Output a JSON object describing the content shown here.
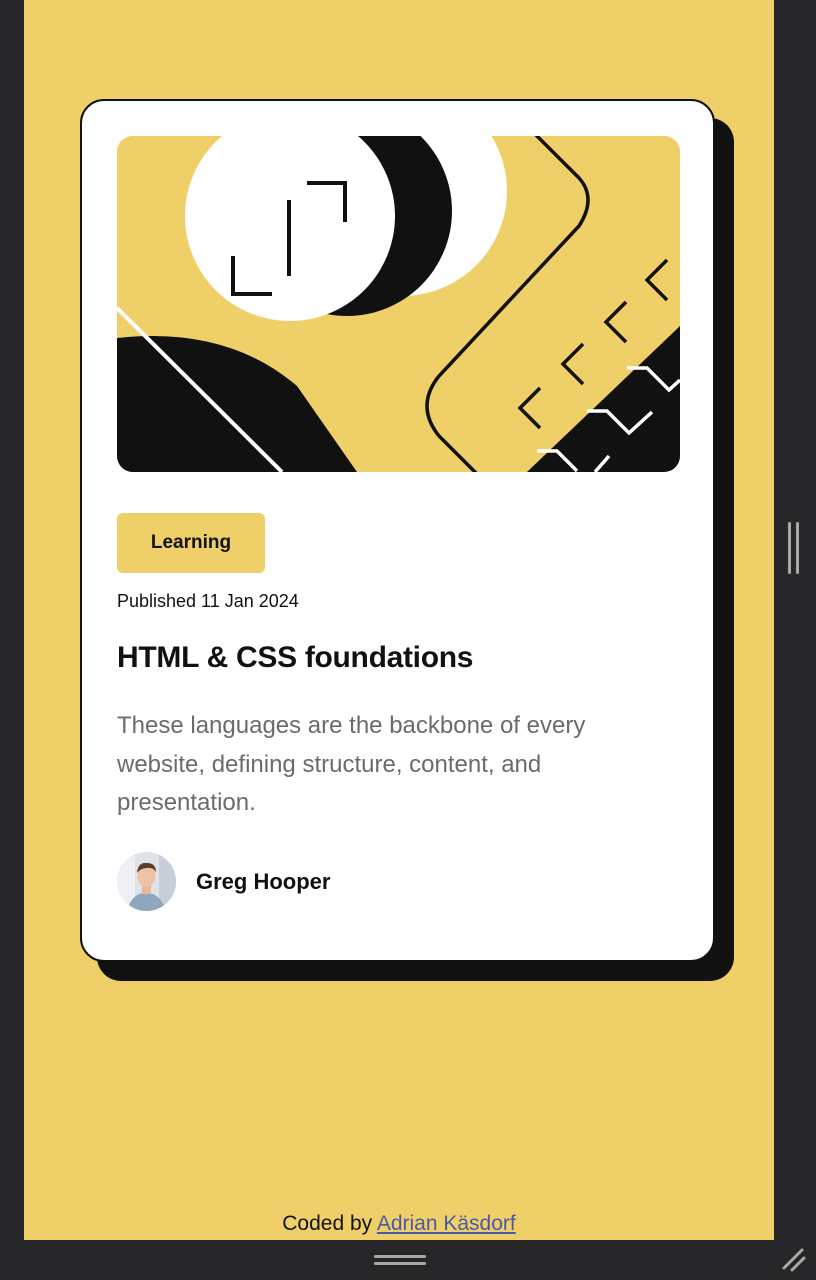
{
  "card": {
    "tag": "Learning",
    "published": "Published 11 Jan 2024",
    "title": "HTML & CSS foundations",
    "description": "These languages are the backbone of every website, defining structure, content, and presentation.",
    "author": {
      "name": "Greg Hooper"
    }
  },
  "footer": {
    "prefix": "Coded by ",
    "link_text": "Adrian Käsdorf"
  },
  "colors": {
    "background": "#EFCF68",
    "card": "#FFFFFF",
    "ink": "#111111",
    "muted_text": "#6B6B6B",
    "link": "#4A5AA8"
  },
  "icons": {
    "hero": "abstract-illustration",
    "avatar": "author-avatar",
    "side_handle": "drag-handle-icon",
    "bottom_handle": "drag-handle-icon",
    "resize": "resize-grip-icon"
  }
}
